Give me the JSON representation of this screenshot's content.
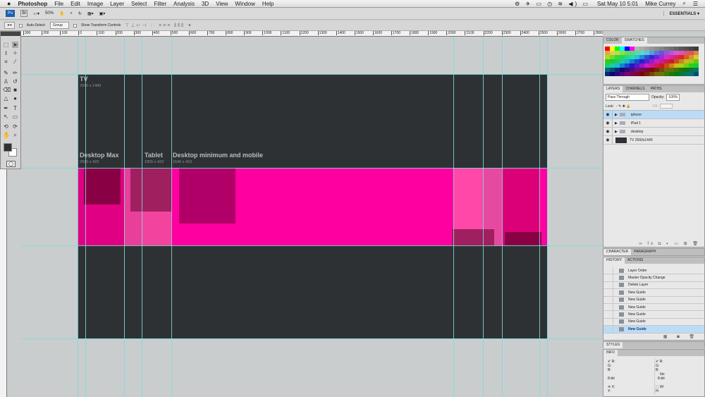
{
  "menubar": {
    "app": "Photoshop",
    "items": [
      "File",
      "Edit",
      "Image",
      "Layer",
      "Select",
      "Filter",
      "Analysis",
      "3D",
      "View",
      "Window",
      "Help"
    ],
    "clock": "Sat May 10  5:01",
    "user": "Mike Currey"
  },
  "appbar": {
    "ps": "Ps",
    "br": "Br",
    "zoom": "50%",
    "workspace": "ESSENTIALS ▾"
  },
  "options": {
    "auto_select": "Auto-Select:",
    "group": "Group",
    "transform": "Show Transform Controls"
  },
  "ruler": [
    "300",
    "200",
    "100",
    "0",
    "100",
    "200",
    "300",
    "400",
    "500",
    "600",
    "700",
    "800",
    "900",
    "1000",
    "1100",
    "1200",
    "1300",
    "1400",
    "1500",
    "1600",
    "1700",
    "1800",
    "1900",
    "2000",
    "2100",
    "2200",
    "2300",
    "2400",
    "2500",
    "2600",
    "2700",
    "2800"
  ],
  "canvas": {
    "tv": "TV",
    "tv_size": "2560 x 1440",
    "dmax": "Desktop Max",
    "dmax_size": "2560 x 423",
    "tablet": "Tablet",
    "tablet_size": "1855 x 423",
    "dmin": "Desktop minimum and mobile",
    "dmin_size": "1546 x 423"
  },
  "colors": {
    "pink": "#ff00a0",
    "dark": "#2e3133",
    "guide": "#7fd8e0"
  },
  "swatches": {
    "tabs": [
      "COLOR",
      "SWATCHES"
    ]
  },
  "layers": {
    "tabs": [
      "LAYERS",
      "CHANNELS",
      "PATHS"
    ],
    "blend": "Pass Through",
    "opacity_label": "Opacity:",
    "opacity": "100%",
    "lock": "Lock:",
    "fill": "Fill:",
    "items": [
      "iphone",
      "iPad 1",
      "desktop",
      "TV 2560x1440"
    ]
  },
  "character": {
    "tabs": [
      "CHARACTER",
      "PARAGRAPH"
    ]
  },
  "history": {
    "tabs": [
      "HISTORY",
      "ACTIONS"
    ],
    "items": [
      "Layer Order",
      "Master Opacity Change",
      "Delete Layer",
      "New Guide",
      "New Guide",
      "New Guide",
      "New Guide",
      "New Guide",
      "New Guide"
    ]
  },
  "styles": {
    "tab": "STYLES"
  },
  "info": {
    "tab": "INFO",
    "rgb": "R:\nG:\nB:",
    "bit": "8-bit",
    "idx": "Idx",
    "xy": "X:\nY:",
    "wh": "W:\nH:"
  }
}
